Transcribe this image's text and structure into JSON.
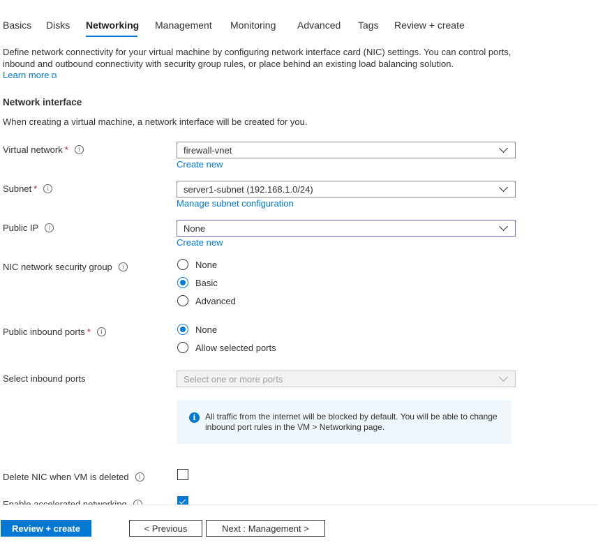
{
  "tabs": [
    "Basics",
    "Disks",
    "Networking",
    "Management",
    "Monitoring",
    "Advanced",
    "Tags",
    "Review + create"
  ],
  "active_tab": "Networking",
  "description": "Define network connectivity for your virtual machine by configuring network interface card (NIC) settings. You can control ports, inbound and outbound connectivity with security group rules, or place behind an existing load balancing solution.",
  "learn_more": "Learn more",
  "section_title": "Network interface",
  "section_sub": "When creating a virtual machine, a network interface will be created for you.",
  "fields": {
    "virtual_network": {
      "label": "Virtual network",
      "required": "*",
      "value": "firewall-vnet",
      "link": "Create new"
    },
    "subnet": {
      "label": "Subnet",
      "required": "*",
      "value": "server1-subnet (192.168.1.0/24)",
      "link": "Manage subnet configuration"
    },
    "public_ip": {
      "label": "Public IP",
      "value": "None",
      "link": "Create new"
    },
    "nic_nsg": {
      "label": "NIC network security group",
      "options": [
        "None",
        "Basic",
        "Advanced"
      ],
      "selected": "Basic"
    },
    "public_inbound_ports": {
      "label": "Public inbound ports",
      "required": "*",
      "options": [
        "None",
        "Allow selected ports"
      ],
      "selected": "None"
    },
    "select_inbound_ports": {
      "label": "Select inbound ports",
      "placeholder": "Select one or more ports"
    }
  },
  "info_box": "All traffic from the internet will be blocked by default. You will be able to change inbound port rules in the VM > Networking page.",
  "delete_nic": {
    "label": "Delete NIC when VM is deleted",
    "checked": false
  },
  "accelerated": {
    "label": "Enable accelerated networking",
    "checked": true
  },
  "footer": {
    "review": "Review + create",
    "previous": "< Previous",
    "next": "Next : Management >"
  },
  "colors": {
    "accent": "#0078d4",
    "required": "#a4262c",
    "focus_border": "#8764b8",
    "info_bg": "#eff6fc"
  }
}
